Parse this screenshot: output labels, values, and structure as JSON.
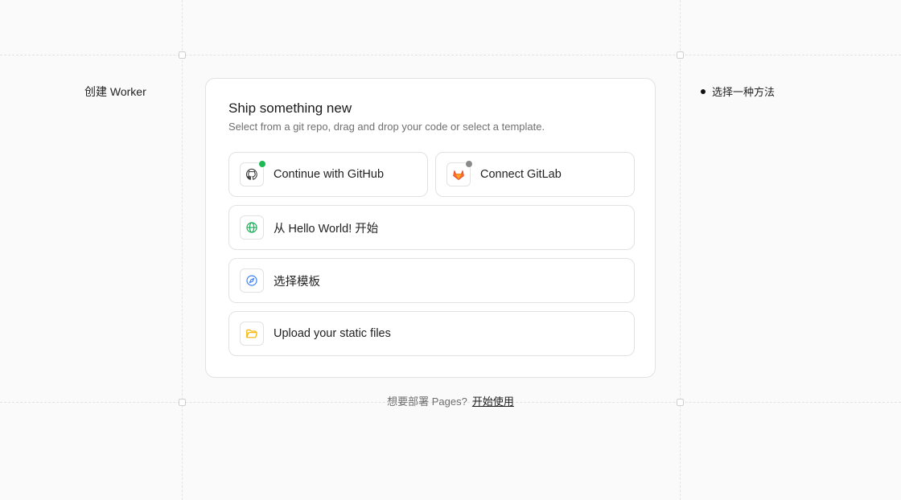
{
  "sidebar": {
    "label": "创建 Worker"
  },
  "steps": {
    "current": "选择一种方法"
  },
  "card": {
    "title": "Ship something new",
    "subtitle": "Select from a git repo, drag and drop your code or select a template."
  },
  "options": {
    "github": {
      "label": "Continue with GitHub",
      "icon": "github-icon",
      "status": "connected",
      "status_color": "#1db954"
    },
    "gitlab": {
      "label": "Connect GitLab",
      "icon": "gitlab-icon",
      "status": "disconnected",
      "status_color": "#8a8a8a"
    },
    "hello_world": {
      "label": "从 Hello World! 开始",
      "icon": "globe-icon"
    },
    "template": {
      "label": "选择模板",
      "icon": "compass-icon"
    },
    "upload": {
      "label": "Upload your static files",
      "icon": "folder-icon"
    }
  },
  "footer": {
    "text": "想要部署 Pages?",
    "link": "开始使用"
  },
  "colors": {
    "github_status": "#1db954",
    "gitlab_status": "#8a8a8a",
    "gitlab_brand": "#fc6d26",
    "globe": "#1fae5b",
    "compass": "#3b82f6",
    "folder": "#f5b301"
  }
}
